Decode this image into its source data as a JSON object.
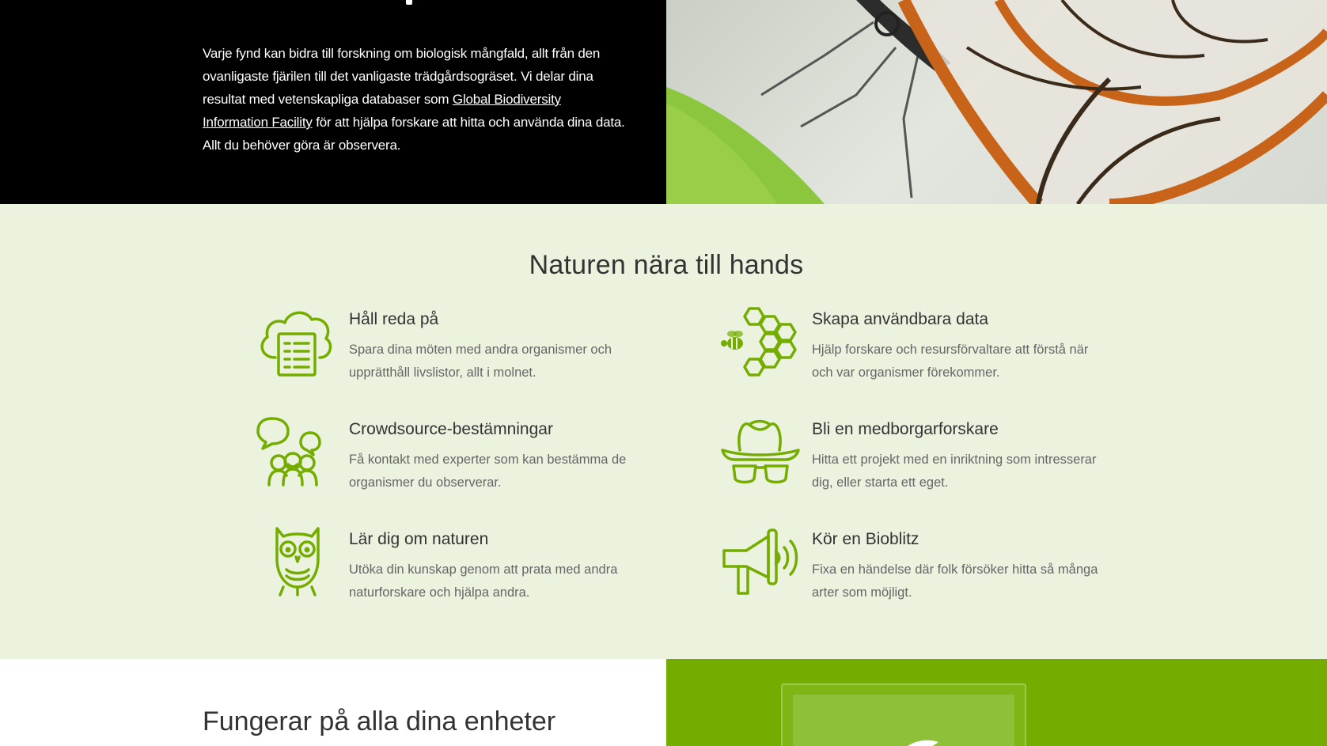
{
  "hero": {
    "paragraph_pre": "Varje fynd kan bidra till forskning om biologisk mångfald, allt från den ovanligaste fjärilen till det vanligaste trädgårdsogräset. Vi delar dina resultat med vetenskapliga databaser som ",
    "link": "Global Biodiversity Information Facility",
    "paragraph_post": " för att hjälpa forskare att hitta och använda dina data. Allt du behöver göra är observera."
  },
  "features": {
    "title": "Naturen nära till hands",
    "items": [
      {
        "title": "Håll reda på",
        "desc": "Spara dina möten med andra organismer och upprätthåll livslistor, allt i molnet.",
        "icon": "cloud-list-icon"
      },
      {
        "title": "Skapa användbara data",
        "desc": "Hjälp forskare och resursförvaltare att förstå när och var organismer förekommer.",
        "icon": "bee-honeycomb-icon"
      },
      {
        "title": "Crowdsource-bestämningar",
        "desc": "Få kontakt med experter som kan bestämma de organismer du observerar.",
        "icon": "people-chat-icon"
      },
      {
        "title": "Bli en medborgarforskare",
        "desc": "Hitta ett projekt med en inriktning som intresserar dig, eller starta ett eget.",
        "icon": "explorer-hat-icon"
      },
      {
        "title": "Lär dig om naturen",
        "desc": "Utöka din kunskap genom att prata med andra naturforskare och hjälpa andra.",
        "icon": "owl-icon"
      },
      {
        "title": "Kör en Bioblitz",
        "desc": "Fixa en händelse där folk försöker hitta så många arter som möjligt.",
        "icon": "megaphone-icon"
      }
    ]
  },
  "devices": {
    "title": "Fungerar på alla dina enheter"
  },
  "colors": {
    "hero_bg": "#000000",
    "features_bg": "#ebf3df",
    "icon_green": "#74ac00",
    "devices_green": "#74ac00"
  }
}
